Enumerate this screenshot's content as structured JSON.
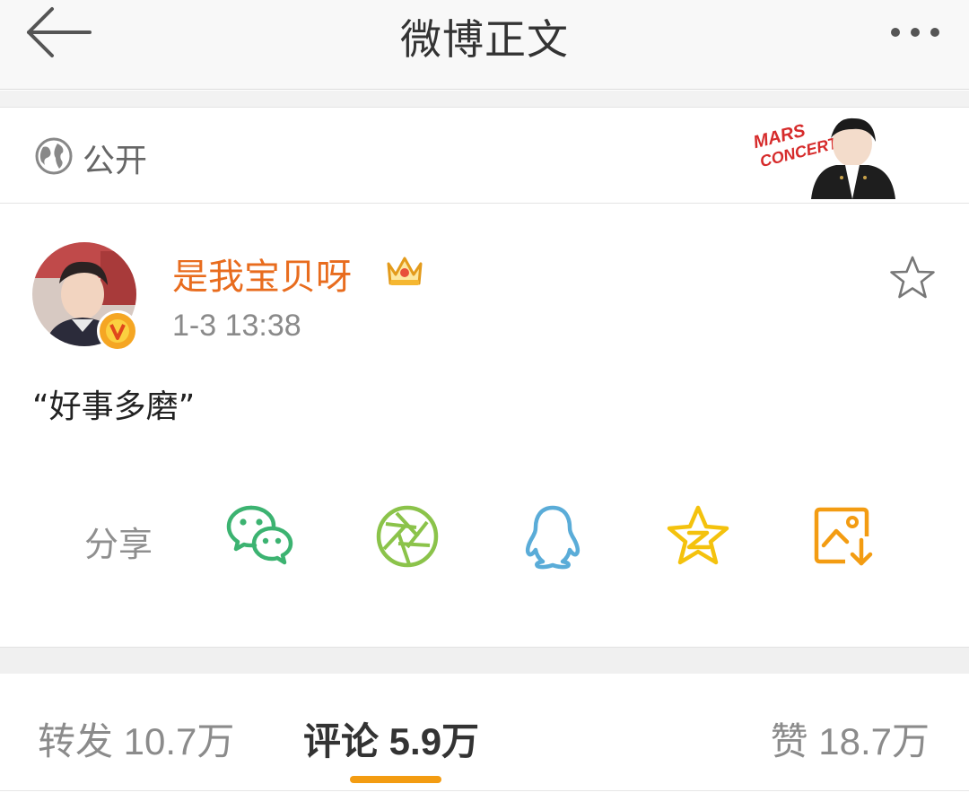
{
  "navbar": {
    "title": "微博正文",
    "back_icon": "arrow-left-icon",
    "more_icon": "more-dots-icon"
  },
  "visibility": {
    "icon": "globe-icon",
    "label": "公开"
  },
  "post": {
    "username": "是我宝贝呀",
    "username_color": "#e86c1e",
    "verified_badge": "V",
    "time": "1-3 13:38",
    "text": "“好事多磨”"
  },
  "share": {
    "label": "分享",
    "targets": [
      {
        "name": "wechat-icon",
        "color": "#3cb371"
      },
      {
        "name": "moments-icon",
        "color": "#8bc34a"
      },
      {
        "name": "qq-icon",
        "color": "#5aacd8"
      },
      {
        "name": "qzone-icon",
        "color": "#f4c20d"
      },
      {
        "name": "save-image-icon",
        "color": "#f39c12"
      }
    ]
  },
  "tabs": {
    "repost": "转发 10.7万",
    "comments": "评论 5.9万",
    "likes": "赞 18.7万",
    "active": "comments",
    "accent": "#f39c12"
  }
}
